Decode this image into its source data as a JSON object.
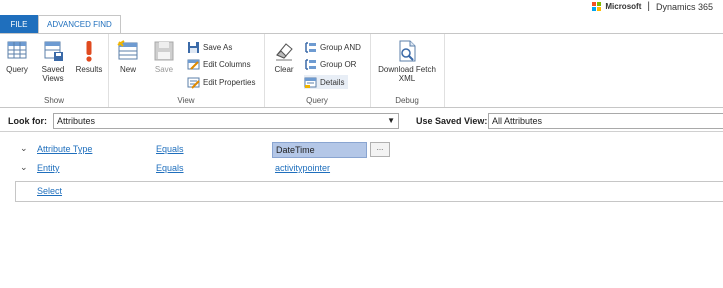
{
  "brand": {
    "company": "Microsoft",
    "product": "Dynamics 365"
  },
  "tabs": [
    {
      "label": "FILE"
    },
    {
      "label": "ADVANCED FIND"
    }
  ],
  "ribbon": {
    "groups": [
      {
        "label": "Show",
        "buttons": [
          "Query",
          "Saved Views",
          "Results"
        ]
      },
      {
        "label": "View",
        "buttons": [
          "New",
          "Save"
        ],
        "small": [
          "Save As",
          "Edit Columns",
          "Edit Properties"
        ]
      },
      {
        "label": "Query",
        "buttons": [
          "Clear"
        ],
        "small": [
          "Group AND",
          "Group OR",
          "Details"
        ]
      },
      {
        "label": "Debug",
        "buttons": [
          "Download Fetch XML"
        ]
      }
    ],
    "saved_views_l1": "Saved",
    "saved_views_l2": "Views",
    "fetch_l1": "Download Fetch",
    "fetch_l2": "XML"
  },
  "look_for": {
    "label": "Look for:",
    "value": "Attributes"
  },
  "use_saved_view": {
    "label": "Use Saved View:",
    "value": "All Attributes"
  },
  "rows": [
    {
      "field": "Attribute Type",
      "operator": "Equals",
      "value": "DateTime"
    },
    {
      "field": "Entity",
      "operator": "Equals",
      "value": "activitypointer"
    }
  ],
  "lookup_button": "...",
  "select_link": "Select",
  "colors": {
    "accent": "#1f6fbd",
    "highlight": "#b4c7e7"
  }
}
